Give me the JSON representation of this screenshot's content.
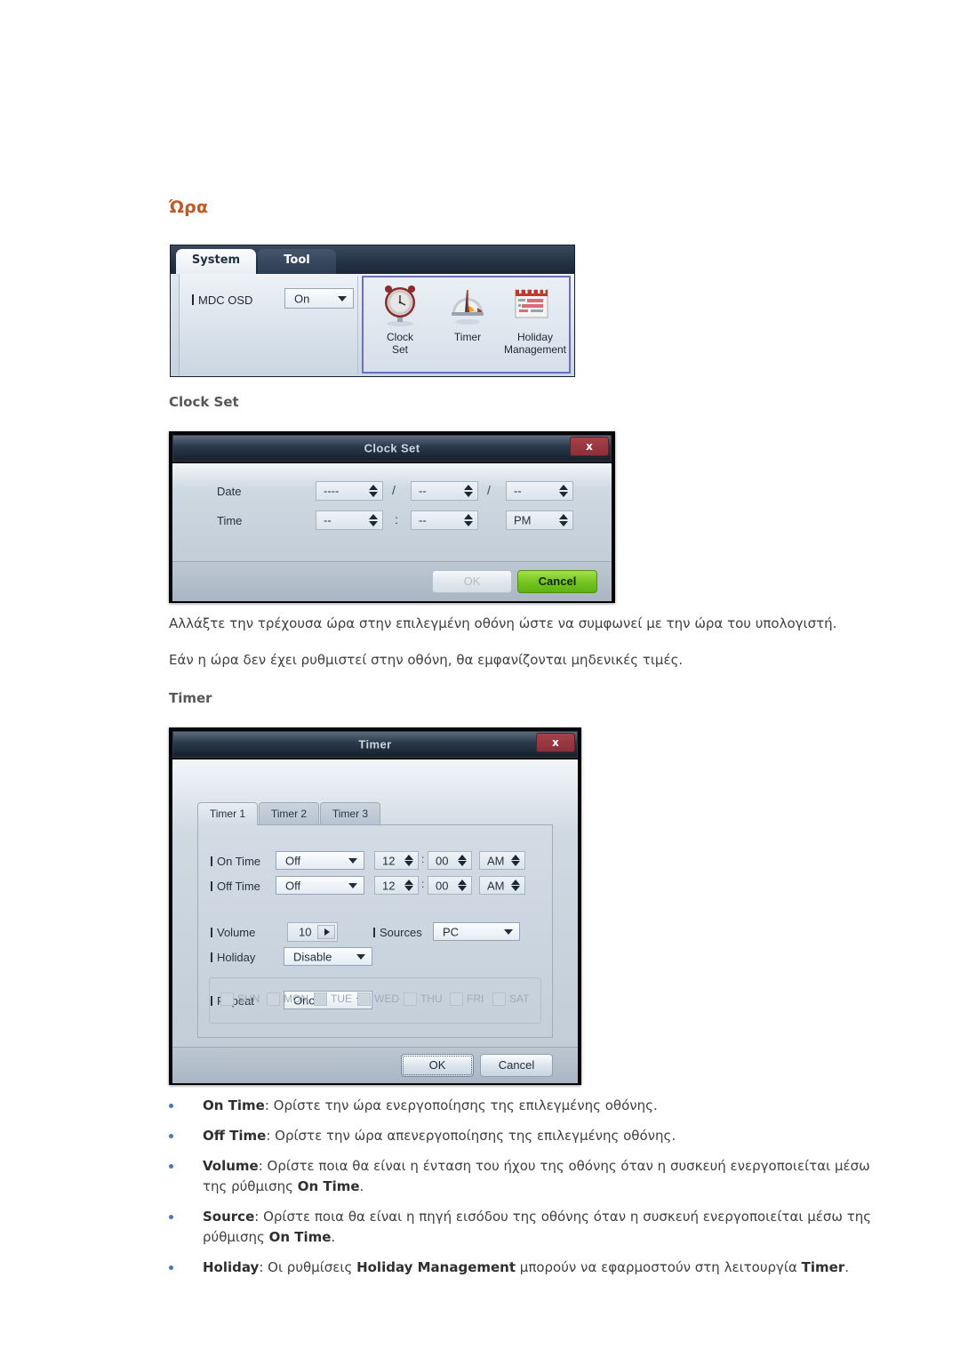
{
  "page": {
    "heading": "Ώρα",
    "sub_headings": {
      "clock_set": "Clock Set",
      "timer": "Timer"
    },
    "paragraphs": {
      "p1": "Αλλάξτε την τρέχουσα ώρα στην επιλεγμένη οθόνη ώστε να συμφωνεί με την ώρα του υπολογιστή.",
      "p2": "Εάν η ώρα δεν έχει ρυθμιστεί στην οθόνη, θα εμφανίζονται μηδενικές τιμές."
    }
  },
  "colors": {
    "heading": "#c05a27",
    "sub_heading": "#575757",
    "body_text": "#404040",
    "bullet": "#4a78b5",
    "ribbon_selection": "#6e6fc4",
    "close_button": "#8c2f38",
    "cancel_green": "#74c51f"
  },
  "ribbon": {
    "tabs": [
      {
        "label": "System",
        "active": true
      },
      {
        "label": "Tool",
        "active": false
      }
    ],
    "mdc_osd": {
      "label": "MDC OSD",
      "value": "On"
    },
    "items": [
      {
        "icon": "clock-icon",
        "label": "Clock\nSet"
      },
      {
        "icon": "timer-icon",
        "label": "Timer"
      },
      {
        "icon": "calendar-icon",
        "label": "Holiday\nManagement"
      }
    ],
    "item_labels": {
      "clock_line1": "Clock",
      "clock_line2": "Set",
      "timer": "Timer",
      "holiday_line1": "Holiday",
      "holiday_line2": "Management"
    }
  },
  "clock_set_dialog": {
    "title": "Clock Set",
    "close_label": "x",
    "rows": [
      {
        "label": "Date",
        "fields": [
          {
            "value": "----",
            "name": "year-spinner"
          },
          {
            "value": "--",
            "name": "month-spinner"
          },
          {
            "value": "--",
            "name": "day-spinner"
          }
        ],
        "separators": [
          "/",
          "/"
        ]
      },
      {
        "label": "Time",
        "fields": [
          {
            "value": "--",
            "name": "hour-spinner"
          },
          {
            "value": "--",
            "name": "minute-spinner"
          },
          {
            "value": "PM",
            "name": "meridiem-spinner"
          }
        ],
        "separators": [
          ":"
        ]
      }
    ],
    "buttons": {
      "ok": "OK",
      "cancel": "Cancel"
    }
  },
  "timer_dialog": {
    "title": "Timer",
    "close_label": "x",
    "tabs": [
      {
        "label": "Timer 1",
        "active": true
      },
      {
        "label": "Timer 2",
        "active": false
      },
      {
        "label": "Timer 3",
        "active": false
      }
    ],
    "fields": {
      "on_time": {
        "label": "On Time",
        "mode": "Off",
        "hour": "12",
        "minute": "00",
        "meridiem": "AM"
      },
      "off_time": {
        "label": "Off Time",
        "mode": "Off",
        "hour": "12",
        "minute": "00",
        "meridiem": "AM"
      },
      "volume": {
        "label": "Volume",
        "value": "10"
      },
      "sources": {
        "label": "Sources",
        "value": "PC"
      },
      "holiday": {
        "label": "Holiday",
        "value": "Disable"
      },
      "repeat": {
        "label": "Repeat",
        "value": "Once"
      }
    },
    "time_separator": ":",
    "weekdays": [
      {
        "label": "SUN",
        "checked": false
      },
      {
        "label": "MON",
        "checked": false
      },
      {
        "label": "TUE",
        "checked": false
      },
      {
        "label": "WED",
        "checked": false
      },
      {
        "label": "THU",
        "checked": false
      },
      {
        "label": "FRI",
        "checked": false
      },
      {
        "label": "SAT",
        "checked": false
      }
    ],
    "buttons": {
      "ok": "OK",
      "cancel": "Cancel"
    }
  },
  "bullets": [
    {
      "term": "On Time",
      "rest": ": Ορίστε την ώρα ενεργοποίησης της επιλεγμένης οθόνης."
    },
    {
      "term": "Off Time",
      "rest": ": Ορίστε την ώρα απενεργοποίησης της επιλεγμένης οθόνης."
    },
    {
      "term": "Volume",
      "rest": ": Ορίστε ποια θα είναι η ένταση του ήχου της οθόνης όταν η συσκευή ενεργοποιείται μέσω της ρύθμισης ",
      "term2": "On Time",
      "tail": "."
    },
    {
      "term": "Source",
      "rest": ": Ορίστε ποια θα είναι η πηγή εισόδου της οθόνης όταν η συσκευή ενεργοποιείται μέσω της ρύθμισης ",
      "term2": "On Time",
      "tail": "."
    },
    {
      "term": "Holiday",
      "rest": ": Οι ρυθμίσεις ",
      "term2": "Holiday Management",
      "rest2": " μπορούν να εφαρμοστούν στη λειτουργία ",
      "term3": "Timer",
      "tail": "."
    }
  ]
}
